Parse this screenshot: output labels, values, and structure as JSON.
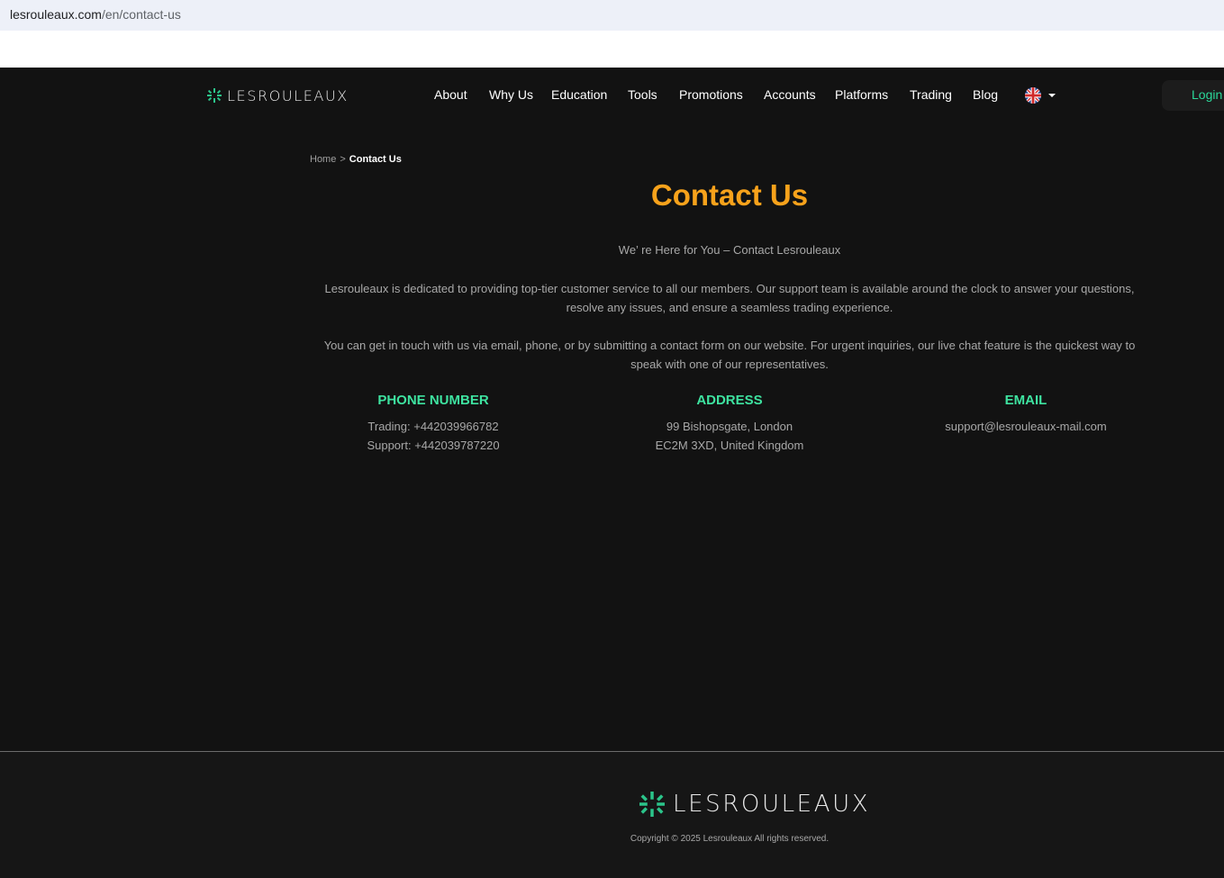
{
  "browser": {
    "url_host": "lesrouleaux.com",
    "url_path": "/en/contact-us"
  },
  "header": {
    "logo_text": "LESROULEAUX",
    "nav": [
      {
        "label": "About"
      },
      {
        "label": "Why Us"
      },
      {
        "label": "Education"
      },
      {
        "label": "Tools"
      },
      {
        "label": "Promotions"
      },
      {
        "label": "Accounts"
      },
      {
        "label": "Platforms"
      },
      {
        "label": "Trading"
      },
      {
        "label": "Blog"
      }
    ],
    "language_icon": "uk-flag-icon",
    "login_label": "Login"
  },
  "breadcrumb": {
    "home": "Home",
    "separator": ">",
    "current": "Contact Us"
  },
  "main": {
    "title": "Contact Us",
    "subtitle": "We’ re Here for You – Contact Lesrouleaux",
    "paragraph1": "Lesrouleaux is dedicated to providing top-tier customer service to all our members. Our support team is available around the clock to answer your questions, resolve any issues, and ensure a seamless trading experience.",
    "paragraph2": "You can get in touch with us via email, phone, or by submitting a contact form on our website. For urgent inquiries, our live chat feature is the quickest way to speak with one of our representatives.",
    "phone": {
      "heading": "PHONE NUMBER",
      "trading": "Trading: +442039966782",
      "support": "Support: +442039787220"
    },
    "address": {
      "heading": "ADDRESS",
      "line1": "99 Bishopsgate, London",
      "line2": "EC2M 3XD, United Kingdom"
    },
    "email": {
      "heading": "EMAIL",
      "value": "support@lesrouleaux-mail.com"
    }
  },
  "footer": {
    "logo_text": "LESROULEAUX",
    "copyright": "Copyright © 2025 Lesrouleaux All rights reserved."
  },
  "colors": {
    "background": "#121212",
    "accent_orange": "#f7a21b",
    "accent_green": "#3ee3a0",
    "login_green": "#2bd99a"
  }
}
